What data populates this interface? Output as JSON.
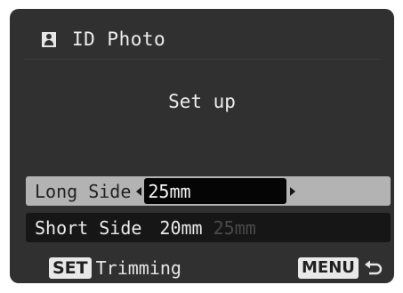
{
  "header": {
    "icon": "id-photo-icon",
    "title": "ID Photo"
  },
  "subtitle": "Set up",
  "settings": {
    "long_side": {
      "label": "Long Side",
      "value": "25mm",
      "selected": true
    },
    "short_side": {
      "label": "Short Side",
      "value": "20mm",
      "max_hint": "25mm",
      "selected": false
    }
  },
  "footer": {
    "set_button": "SET",
    "set_label": "Trimming",
    "menu_button": "MENU",
    "menu_icon": "return-arrow-icon"
  },
  "colors": {
    "screen_bg": "#303030",
    "highlight_row": "#b3b3b3",
    "value_box": "#050505",
    "dark_row": "#161616"
  }
}
